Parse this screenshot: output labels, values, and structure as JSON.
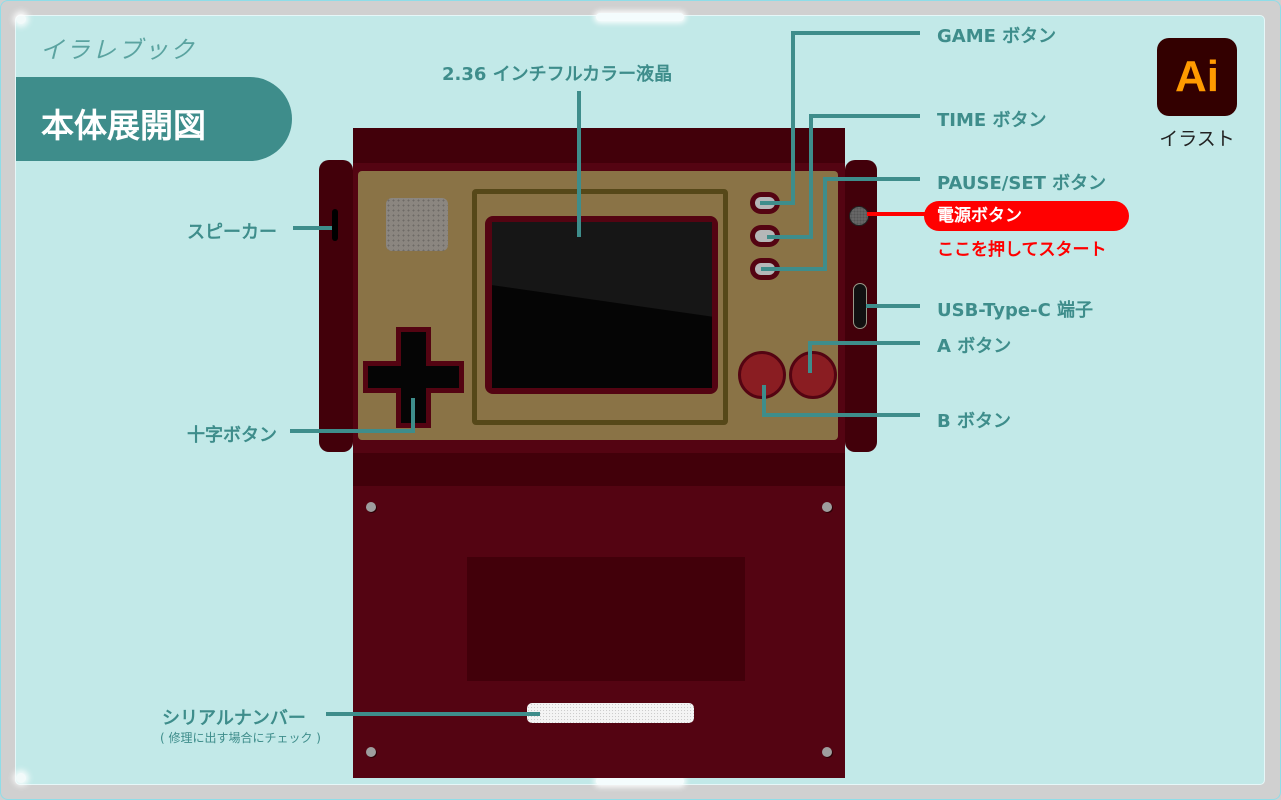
{
  "brand": "イラレブック",
  "title": "本体展開図",
  "app_badge": {
    "icon": "illustrator-icon",
    "text": "Ai",
    "caption": "イラスト"
  },
  "labels": {
    "screen": "2.36 インチフルカラー液晶",
    "speaker": "スピーカー",
    "dpad": "十字ボタン",
    "game_button": "GAME ボタン",
    "time_button": "TIME ボタン",
    "pause_set_button": "PAUSE/SET ボタン",
    "power_button": "電源ボタン",
    "power_hint": "ここを押してスタート",
    "usb": "USB-Type-C 端子",
    "a_button": "A ボタン",
    "b_button": "B ボタン",
    "serial": "シリアルナンバー",
    "serial_note": "( 修理に出す場合にチェック )"
  },
  "colors": {
    "panel_bg": "#c2e9e8",
    "accent_teal": "#3e8d8b",
    "body_red": "#540412",
    "body_dark": "#42000a",
    "face_gold": "#8a7346",
    "power_red": "#ff0000",
    "ai_orange": "#ff9a00"
  }
}
